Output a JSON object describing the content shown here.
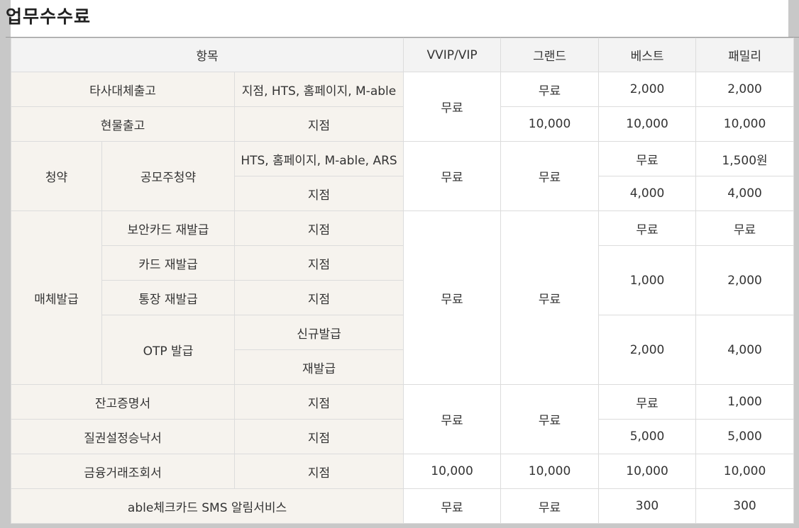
{
  "title": "업무수수료",
  "headers": {
    "item": "항목",
    "vvip": "VVIP/VIP",
    "grand": "그랜드",
    "best": "베스트",
    "family": "패밀리"
  },
  "rows": {
    "r1": {
      "name": "타사대체출고",
      "channel": "지점, HTS, 홈페이지, M-able",
      "vvip": "무료",
      "grand": "무료",
      "best": "2,000",
      "family": "2,000"
    },
    "r2": {
      "name": "현물출고",
      "channel": "지점",
      "grand": "10,000",
      "best": "10,000",
      "family": "10,000"
    },
    "r3": {
      "group": "청약",
      "name": "공모주청약",
      "channel": "HTS, 홈페이지, M-able, ARS",
      "vvip": "무료",
      "grand": "무료",
      "best": "무료",
      "family": "1,500원"
    },
    "r4": {
      "channel": "지점",
      "best": "4,000",
      "family": "4,000"
    },
    "r5": {
      "group": "매체발급",
      "name": "보안카드 재발급",
      "channel": "지점",
      "vvip": "무료",
      "grand": "무료",
      "best": "무료",
      "family": "무료"
    },
    "r6": {
      "name": "카드 재발급",
      "channel": "지점",
      "best": "1,000",
      "family": "2,000"
    },
    "r7": {
      "name": "통장 재발급",
      "channel": "지점"
    },
    "r8": {
      "name": "OTP 발급",
      "channel": "신규발급",
      "best": "2,000",
      "family": "4,000"
    },
    "r9": {
      "channel": "재발급"
    },
    "r10": {
      "name": "잔고증명서",
      "channel": "지점",
      "vvip": "무료",
      "grand": "무료",
      "best": "무료",
      "family": "1,000"
    },
    "r11": {
      "name": "질권설정승낙서",
      "channel": "지점",
      "best": "5,000",
      "family": "5,000"
    },
    "r12": {
      "name": "금융거래조회서",
      "channel": "지점",
      "vvip": "10,000",
      "grand": "10,000",
      "best": "10,000",
      "family": "10,000"
    },
    "r13": {
      "name": "able체크카드 SMS 알림서비스",
      "vvip": "무료",
      "grand": "무료",
      "best": "300",
      "family": "300"
    }
  },
  "colors": {
    "header_bg": "#f3f3f3",
    "category_bg": "#f6f3ee",
    "border": "#dcdcdc",
    "frame": "#c8c8c8"
  }
}
